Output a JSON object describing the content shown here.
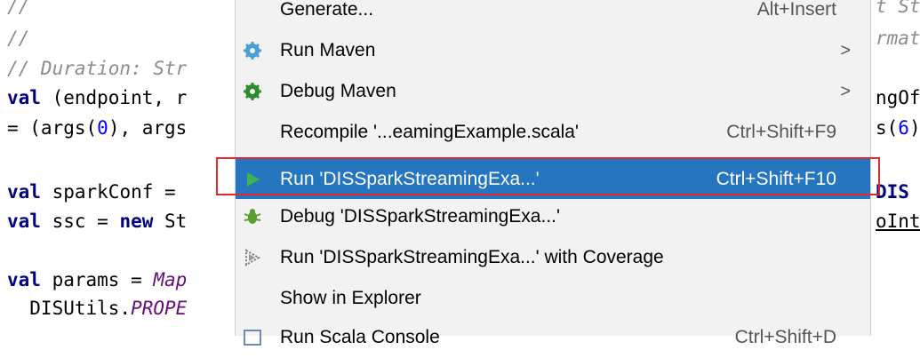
{
  "editor": {
    "left_lines": [
      "//",
      "//",
      "// Duration: Str",
      "val (endpoint, r",
      "= (args(0), args",
      "",
      "val sparkConf =",
      "val ssc = new St",
      "",
      "val params = Map",
      "  DISUtils.PROPE"
    ],
    "right_lines": [
      "t St",
      "rmat",
      "",
      "ngOf",
      "s(6)",
      "",
      "DIS",
      "oInt"
    ]
  },
  "context_menu": {
    "items": [
      {
        "label": "Generate...",
        "shortcut": "Alt+Insert",
        "icon": "none"
      },
      {
        "label": "Run Maven",
        "shortcut": "",
        "icon": "gear-blue-icon",
        "submenu": true
      },
      {
        "label": "Debug Maven",
        "shortcut": "",
        "icon": "gear-green-icon",
        "submenu": true
      },
      {
        "label": "Recompile '...eamingExample.scala'",
        "shortcut": "Ctrl+Shift+F9",
        "icon": "none"
      },
      {
        "label": "Run 'DISSparkStreamingExa...'",
        "shortcut": "Ctrl+Shift+F10",
        "icon": "play-icon",
        "selected": true
      },
      {
        "label": "Debug 'DISSparkStreamingExa...'",
        "shortcut": "",
        "icon": "bug-icon"
      },
      {
        "label": "Run 'DISSparkStreamingExa...' with Coverage",
        "shortcut": "",
        "icon": "coverage-icon"
      },
      {
        "label": "Show in Explorer",
        "shortcut": "",
        "icon": "none"
      },
      {
        "label": "Run Scala Console",
        "shortcut": "Ctrl+Shift+D",
        "icon": "console-icon"
      }
    ],
    "submenu_arrow": ">"
  },
  "colors": {
    "selection": "#2675bf",
    "highlight_border": "#e0282e",
    "menu_bg": "#f2f2f2"
  }
}
